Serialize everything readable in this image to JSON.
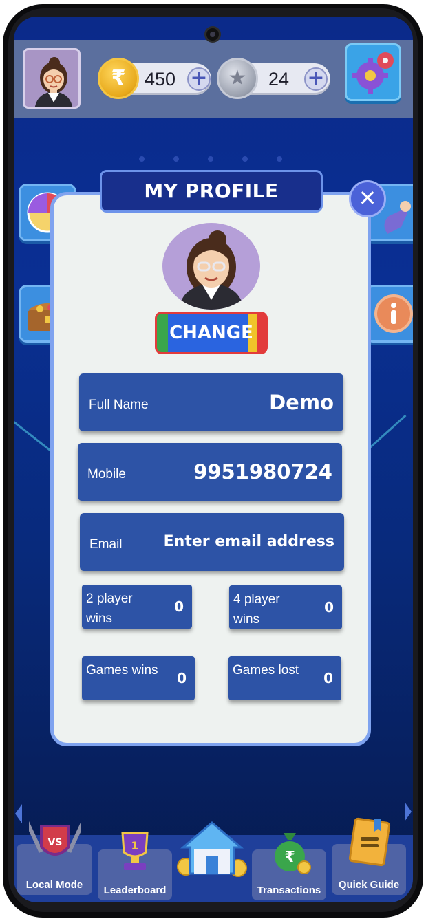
{
  "topbar": {
    "coins": "450",
    "stars": "24",
    "coin_icon": "rupee-coin-icon",
    "star_icon": "star-coin-icon",
    "add_icon": "plus-icon",
    "settings_icon": "gear-icon"
  },
  "modal": {
    "title": "MY PROFILE",
    "change_label": "CHANGE",
    "close_icon": "close-icon",
    "fields": [
      {
        "label": "Full Name",
        "value": "Demo"
      },
      {
        "label": "Mobile",
        "value": "9951980724"
      },
      {
        "label": "Email",
        "placeholder": "Enter email address"
      }
    ],
    "stats": [
      {
        "label": "2 player wins",
        "value": "0"
      },
      {
        "label": "4 player wins",
        "value": "0"
      },
      {
        "label": "Games wins",
        "value": "0"
      },
      {
        "label": "Games lost",
        "value": "0"
      }
    ]
  },
  "nav": [
    {
      "label": "Local Mode",
      "icon": "vs-shield-icon"
    },
    {
      "label": "Leaderboard",
      "icon": "trophy-icon"
    },
    {
      "label": "",
      "icon": "home-icon"
    },
    {
      "label": "Transactions",
      "icon": "money-bag-icon"
    },
    {
      "label": "Quick Guide",
      "icon": "book-icon"
    }
  ],
  "colors": {
    "background": "#0a2f93",
    "topbar": "#5b6f9e",
    "modal_bg": "#eef2f0",
    "field_bg": "#2d53a6",
    "title_bg": "#182f8c"
  }
}
